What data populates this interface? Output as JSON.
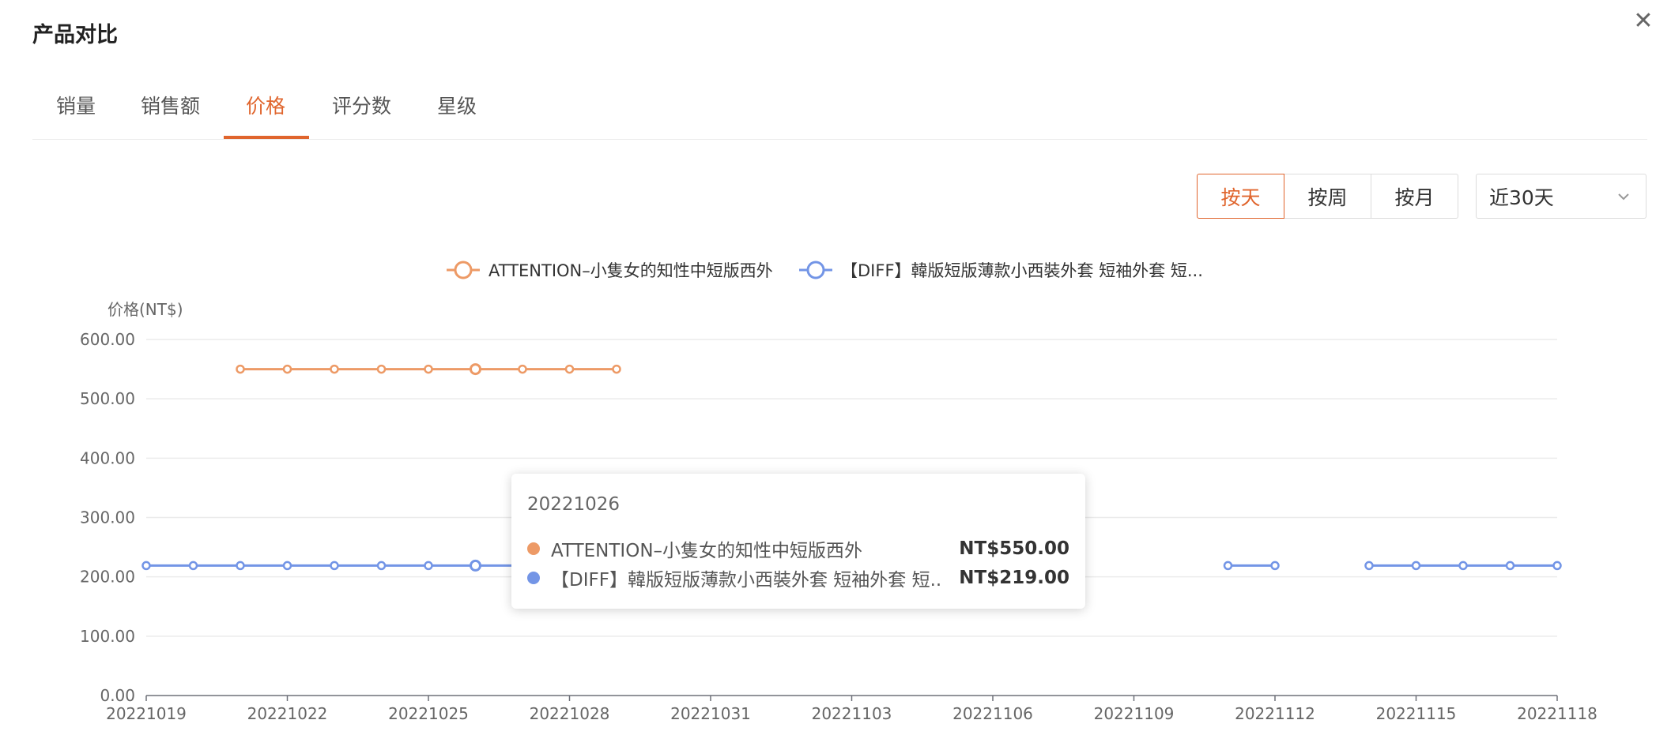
{
  "dialog": {
    "title": "产品对比",
    "close_label": "✕"
  },
  "tabs": [
    {
      "label": "销量",
      "active": false
    },
    {
      "label": "销售额",
      "active": false
    },
    {
      "label": "价格",
      "active": true
    },
    {
      "label": "评分数",
      "active": false
    },
    {
      "label": "星级",
      "active": false
    }
  ],
  "period_buttons": [
    {
      "label": "按天",
      "active": true
    },
    {
      "label": "按周",
      "active": false
    },
    {
      "label": "按月",
      "active": false
    }
  ],
  "range_select": {
    "value": "近30天"
  },
  "colors": {
    "accent": "#e0652d",
    "series_orange": "#ed9a66",
    "series_blue": "#7395e6",
    "grid": "#ebebeb"
  },
  "chart_data": {
    "type": "line",
    "ylabel": "价格(NT$)",
    "ylim": [
      0,
      600
    ],
    "y_ticks": [
      "0.00",
      "100.00",
      "200.00",
      "300.00",
      "400.00",
      "500.00",
      "600.00"
    ],
    "x_tick_labels": [
      "20221019",
      "20221022",
      "20221025",
      "20221028",
      "20221031",
      "20221103",
      "20221106",
      "20221109",
      "20221112",
      "20221115",
      "20221118"
    ],
    "legend_position": "top-center",
    "grid": true,
    "series": [
      {
        "name": "ATTENTION–小隻女的知性中短版西外",
        "color": "#ed9a66",
        "points": [
          {
            "x": "20221021",
            "y": 550
          },
          {
            "x": "20221022",
            "y": 550
          },
          {
            "x": "20221023",
            "y": 550
          },
          {
            "x": "20221024",
            "y": 550
          },
          {
            "x": "20221025",
            "y": 550
          },
          {
            "x": "20221026",
            "y": 550
          },
          {
            "x": "20221027",
            "y": 550
          },
          {
            "x": "20221028",
            "y": 550
          },
          {
            "x": "20221029",
            "y": 550
          }
        ]
      },
      {
        "name": "【DIFF】韓版短版薄款小西裝外套 短袖外套 短...",
        "color": "#7395e6",
        "points": [
          {
            "x": "20221019",
            "y": 219
          },
          {
            "x": "20221020",
            "y": 219
          },
          {
            "x": "20221021",
            "y": 219
          },
          {
            "x": "20221022",
            "y": 219
          },
          {
            "x": "20221023",
            "y": 219
          },
          {
            "x": "20221024",
            "y": 219
          },
          {
            "x": "20221025",
            "y": 219
          },
          {
            "x": "20221026",
            "y": 219
          },
          {
            "x": "20221027",
            "y": 219
          },
          {
            "x": "20221111",
            "y": 219
          },
          {
            "x": "20221112",
            "y": 219
          },
          {
            "x": "20221114",
            "y": 219
          },
          {
            "x": "20221115",
            "y": 219
          },
          {
            "x": "20221116",
            "y": 219
          },
          {
            "x": "20221117",
            "y": 219
          },
          {
            "x": "20221118",
            "y": 219
          }
        ]
      }
    ],
    "tooltip": {
      "date": "20221026",
      "rows": [
        {
          "name": "ATTENTION–小隻女的知性中短版西外",
          "value": "NT$550.00",
          "color": "#ed9a66"
        },
        {
          "name": "【DIFF】韓版短版薄款小西裝外套 短袖外套 短...",
          "value": "NT$219.00",
          "color": "#7395e6"
        }
      ]
    }
  }
}
